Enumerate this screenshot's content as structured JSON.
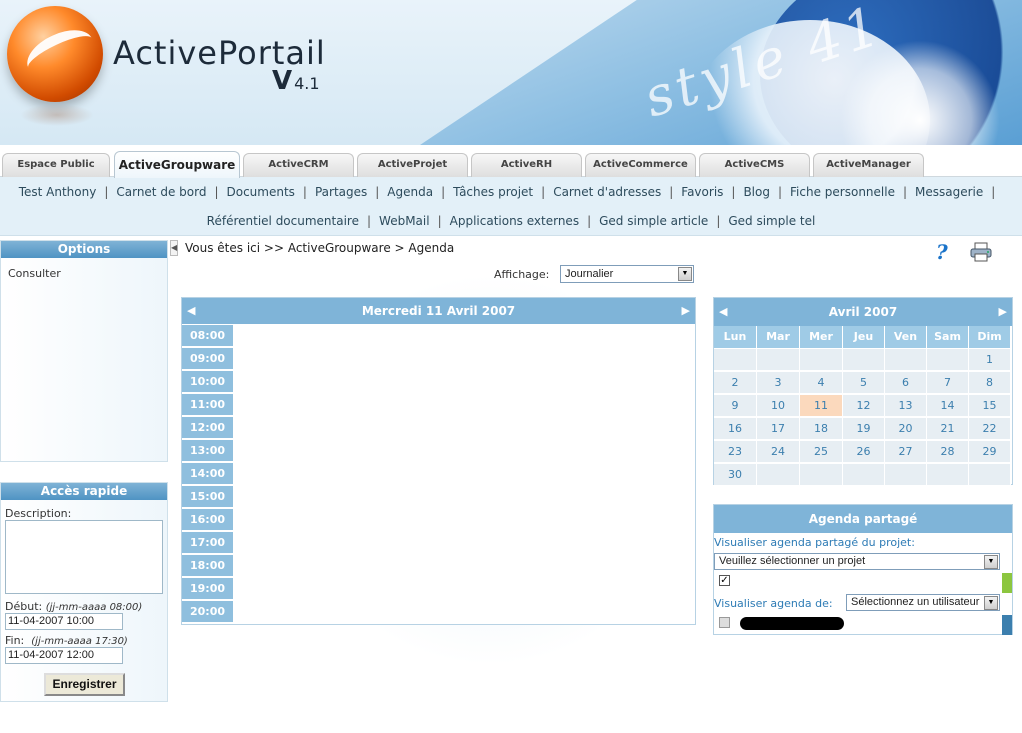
{
  "header": {
    "brand": "ActivePortail",
    "version_v": "V",
    "version_num": "4.1",
    "style_text": "style 41"
  },
  "tabs": [
    {
      "label": "Espace Public",
      "active": false
    },
    {
      "label": "ActiveGroupware",
      "active": true
    },
    {
      "label": "ActiveCRM",
      "active": false
    },
    {
      "label": "ActiveProjet",
      "active": false
    },
    {
      "label": "ActiveRH",
      "active": false
    },
    {
      "label": "ActiveCommerce",
      "active": false
    },
    {
      "label": "ActiveCMS",
      "active": false
    },
    {
      "label": "ActiveManager",
      "active": false
    }
  ],
  "menu": {
    "row1": [
      "Test Anthony",
      "Carnet de bord",
      "Documents",
      "Partages",
      "Agenda",
      "Tâches projet",
      "Carnet d'adresses",
      "Favoris",
      "Blog",
      "Fiche personnelle",
      "Messagerie"
    ],
    "row2": [
      "Référentiel documentaire",
      "WebMail",
      "Applications externes",
      "Ged simple article",
      "Ged simple tel"
    ]
  },
  "sidebar": {
    "options_title": "Options",
    "consulter": "Consulter",
    "quick_title": "Accès rapide",
    "description_label": "Description:",
    "start_label": "Début:",
    "start_hint": "(jj-mm-aaaa 08:00)",
    "start_value": "11-04-2007 10:00",
    "end_label": "Fin:",
    "end_hint": "(jj-mm-aaaa 17:30)",
    "end_value": "11-04-2007 12:00",
    "save_label": "Enregistrer"
  },
  "main": {
    "breadcrumb": "Vous êtes ici >> ActiveGroupware > Agenda",
    "help_glyph": "?",
    "display_label": "Affichage:",
    "display_value": "Journalier"
  },
  "day_calendar": {
    "title": "Mercredi 11 Avril 2007",
    "hours": [
      "08:00",
      "09:00",
      "10:00",
      "11:00",
      "12:00",
      "13:00",
      "14:00",
      "15:00",
      "16:00",
      "17:00",
      "18:00",
      "19:00",
      "20:00"
    ]
  },
  "month_calendar": {
    "title": "Avril 2007",
    "weekdays": [
      "Lun",
      "Mar",
      "Mer",
      "Jeu",
      "Ven",
      "Sam",
      "Dim"
    ],
    "weeks": [
      [
        "",
        "",
        "",
        "",
        "",
        "",
        "1"
      ],
      [
        "2",
        "3",
        "4",
        "5",
        "6",
        "7",
        "8"
      ],
      [
        "9",
        "10",
        "11",
        "12",
        "13",
        "14",
        "15"
      ],
      [
        "16",
        "17",
        "18",
        "19",
        "20",
        "21",
        "22"
      ],
      [
        "23",
        "24",
        "25",
        "26",
        "27",
        "28",
        "29"
      ],
      [
        "30",
        "",
        "",
        "",
        "",
        "",
        ""
      ]
    ],
    "today": "11"
  },
  "shared_agenda": {
    "title": "Agenda partagé",
    "project_label": "Visualiser agenda partagé du projet:",
    "project_value": "Veuillez sélectionner un projet",
    "project_checked": true,
    "user_label": "Visualiser agenda de:",
    "user_value": "Sélectionnez un utilisateur",
    "user_checked": false
  },
  "colors": {
    "header_blue": "#7fb4d8",
    "hour_blue": "#8fbfde",
    "today_highlight": "#fbd9bd",
    "green_marker": "#8cc63f",
    "blue_marker": "#3c7fae"
  }
}
